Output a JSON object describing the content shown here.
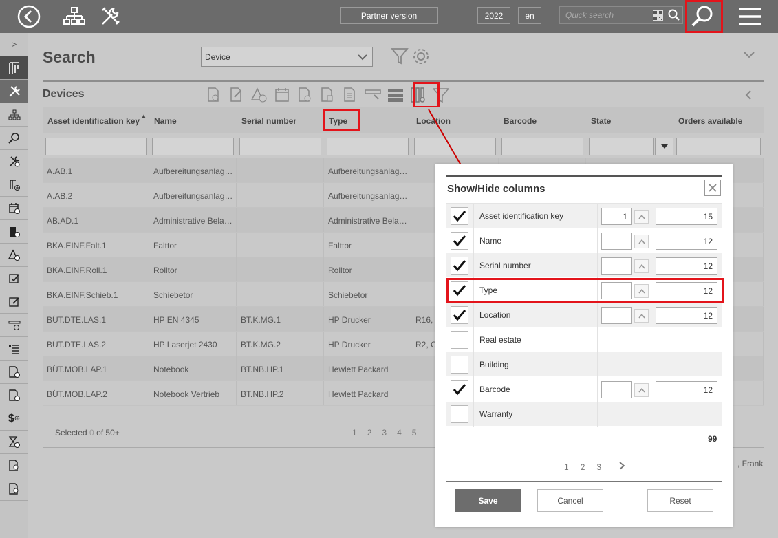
{
  "topbar": {
    "partner_label": "Partner version",
    "year": "2022",
    "language": "en",
    "search_placeholder": "Quick search"
  },
  "header": {
    "title": "Search",
    "object_type": "Device"
  },
  "section": {
    "title": "Devices"
  },
  "grid": {
    "columns": [
      "Asset identification key",
      "Name",
      "Serial number",
      "Type",
      "Location",
      "Barcode",
      "State",
      "Orders available"
    ],
    "rows": [
      [
        "A.AB.1",
        "Aufbereitungsanlag…",
        "",
        "Aufbereitungsanlag…",
        "",
        "",
        "",
        ""
      ],
      [
        "A.AB.2",
        "Aufbereitungsanlag…",
        "",
        "Aufbereitungsanlag…",
        "",
        "",
        "",
        ""
      ],
      [
        "AB.AD.1",
        "Administrative Bela…",
        "",
        "Administrative Bela…",
        "",
        "",
        "",
        ""
      ],
      [
        "BKA.EINF.Falt.1",
        "Falttor",
        "",
        "Falttor",
        "",
        "",
        "",
        ""
      ],
      [
        "BKA.EINF.Roll.1",
        "Rolltor",
        "",
        "Rolltor",
        "",
        "",
        "",
        ""
      ],
      [
        "BKA.EINF.Schieb.1",
        "Schiebetor",
        "",
        "Schiebetor",
        "",
        "",
        "",
        ""
      ],
      [
        "BÜT.DTE.LAS.1",
        "HP EN 4345",
        "BT.K.MG.1",
        "HP Drucker",
        "R16,",
        "",
        "",
        ""
      ],
      [
        "BÜT.DTE.LAS.2",
        "HP Laserjet 2430",
        "BT.K.MG.2",
        "HP Drucker",
        "R2, C",
        "",
        "",
        ""
      ],
      [
        "BÜT.MOB.LAP.1",
        "Notebook",
        "BT.NB.HP.1",
        "Hewlett Packard",
        "",
        "",
        "",
        ""
      ],
      [
        "BÜT.MOB.LAP.2",
        "Notebook Vertrieb",
        "BT.NB.HP.2",
        "Hewlett Packard",
        "",
        "",
        "",
        ""
      ]
    ],
    "selected_prefix": "Selected",
    "selected_count": "0",
    "selected_suffix": "of 50+",
    "pages": [
      "1",
      "2",
      "3",
      "4",
      "5"
    ],
    "footer_user": ", Frank"
  },
  "dialog": {
    "title": "Show/Hide columns",
    "rows": [
      {
        "label": "Asset identification key",
        "checked": true,
        "order": "1",
        "width": "15"
      },
      {
        "label": "Name",
        "checked": true,
        "order": "",
        "width": "12"
      },
      {
        "label": "Serial number",
        "checked": true,
        "order": "",
        "width": "12"
      },
      {
        "label": "Type",
        "checked": true,
        "order": "",
        "width": "12"
      },
      {
        "label": "Location",
        "checked": true,
        "order": "",
        "width": "12"
      },
      {
        "label": "Real estate",
        "checked": false
      },
      {
        "label": "Building",
        "checked": false
      },
      {
        "label": "Barcode",
        "checked": true,
        "order": "",
        "width": "12"
      },
      {
        "label": "Warranty",
        "checked": false
      }
    ],
    "total": "99",
    "pages": [
      "1",
      "2",
      "3"
    ],
    "save_label": "Save",
    "cancel_label": "Cancel",
    "reset_label": "Reset"
  },
  "colors": {
    "highlight": "#e3141b",
    "topbar": "#6b6b6b",
    "overlay": "#c9c9c9"
  }
}
